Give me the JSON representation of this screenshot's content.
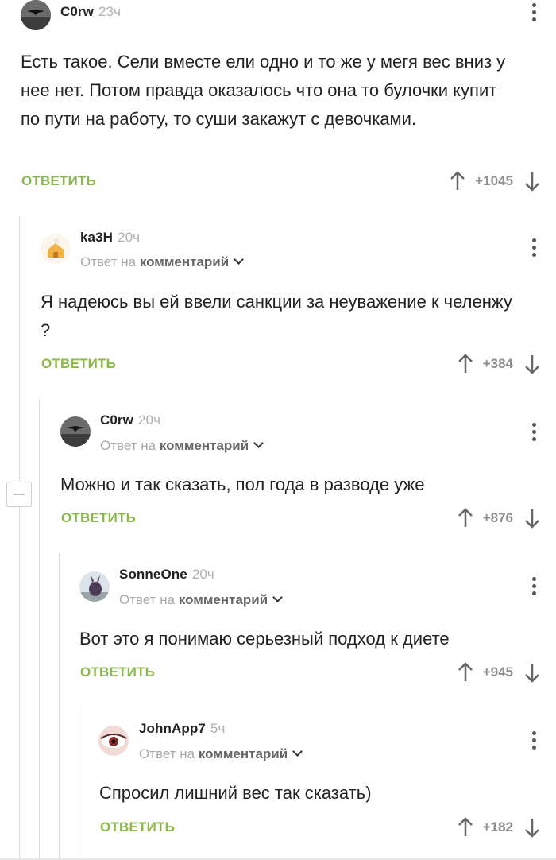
{
  "comments": [
    {
      "author": "C0rw",
      "time": "23ч",
      "reply_prefix": "",
      "reply_target": "",
      "text": "Есть такое. Сели вместе ели одно и то же у мегя вес вниз у нее нет. Потом правда оказалось что она то булочки купит по пути на работу, то суши закажут с девочками.",
      "reply_label": "ОТВЕТИТЬ",
      "rating": "+1045"
    },
    {
      "author": "ka3H",
      "time": "20ч",
      "reply_prefix": "Ответ на",
      "reply_target": "комментарий",
      "text": "Я надеюсь вы ей ввели санкции за неуважение к челенжу ?",
      "reply_label": "ОТВЕТИТЬ",
      "rating": "+384"
    },
    {
      "author": "C0rw",
      "time": "20ч",
      "reply_prefix": "Ответ на",
      "reply_target": "комментарий",
      "text": "Можно и так сказать, пол года в разводе уже",
      "reply_label": "ОТВЕТИТЬ",
      "rating": "+876"
    },
    {
      "author": "SonneOne",
      "time": "20ч",
      "reply_prefix": "Ответ на",
      "reply_target": "комментарий",
      "text": "Вот это я понимаю серьезный подход к диете",
      "reply_label": "ОТВЕТИТЬ",
      "rating": "+945"
    },
    {
      "author": "JohnApp7",
      "time": "5ч",
      "reply_prefix": "Ответ на",
      "reply_target": "комментарий",
      "text": "Спросил лишний вес так сказать)",
      "reply_label": "ОТВЕТИТЬ",
      "rating": "+182"
    }
  ],
  "colors": {
    "accent": "#8ab84a",
    "text": "#222222",
    "muted": "#a9a9a9",
    "thread_line": "#dcdcdc"
  },
  "icons": [
    "crow-avatar",
    "house-avatar",
    "rabbit-avatar",
    "eye-avatar",
    "more-vertical-icon",
    "arrow-up-icon",
    "arrow-down-icon",
    "collapse-icon",
    "chevron-down-icon"
  ]
}
